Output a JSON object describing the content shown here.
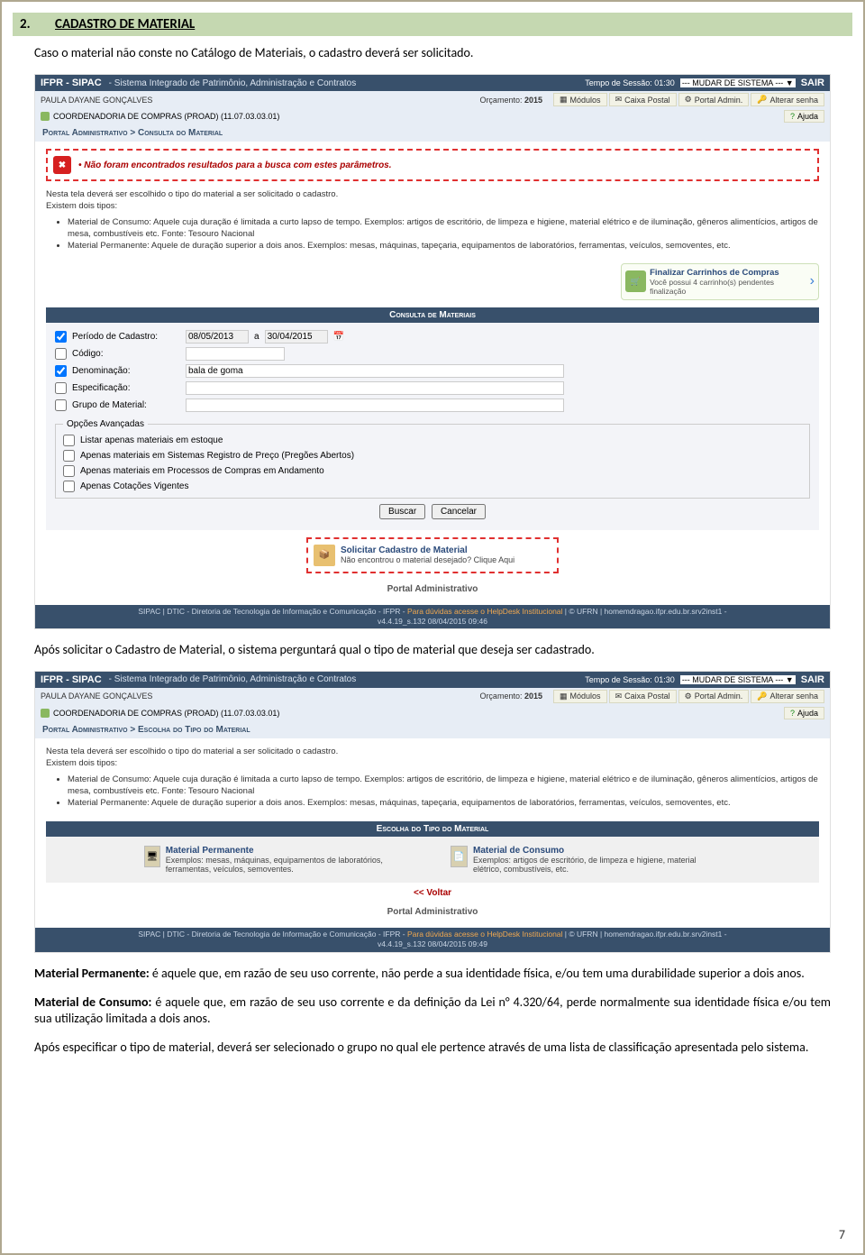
{
  "section": {
    "number": "2.",
    "title": "CADASTRO DE MATERIAL"
  },
  "intro_text": "Caso o material não conste no Catálogo de Materiais, o cadastro deverá ser solicitado.",
  "after_solicit_text": "Após solicitar o Cadastro de Material, o sistema perguntará qual o tipo de material que deseja ser cadastrado.",
  "mat_perm_label": "Material Permanente:",
  "mat_perm_text": " é aquele que, em razão de seu uso corrente, não perde a sua identidade física, e/ou tem uma durabilidade superior a dois anos.",
  "mat_cons_label": "Material de Consumo:",
  "mat_cons_text": " é aquele que, em razão de seu uso corrente e da definição da Lei n° 4.320/64, perde normalmente sua identidade física e/ou tem sua utilização limitada a dois anos.",
  "final_text": "Após especificar o tipo de material, deverá ser selecionado o grupo no qual ele pertence através de uma lista de classificação apresentada pelo sistema.",
  "page_number": "7",
  "app": {
    "brand": "IFPR - SIPAC",
    "subtitle": "- Sistema Integrado de Patrimônio, Administração e Contratos",
    "session": "Tempo de Sessão: 01:30",
    "mudar": "--- MUDAR DE SISTEMA --- ▼",
    "sair": "SAIR",
    "user": "PAULA DAYANE GONÇALVES",
    "dept": "COORDENADORIA DE COMPRAS (PROAD) (11.07.03.03.01)",
    "orcamento_label": "Orçamento:",
    "orcamento_year": "2015",
    "modlinks": {
      "modulos": "Módulos",
      "caixa": "Caixa Postal",
      "portal": "Portal Admin.",
      "alterar": "Alterar senha",
      "ajuda": "Ajuda"
    },
    "footer1": "SIPAC | DTIC - Diretoria de Tecnologia de Informação e Comunicação - IFPR - ",
    "footer_orange": "Para dúvidas acesse o HelpDesk Institucional",
    "footer2": " | © UFRN | homemdragao.ifpr.edu.br.srv2inst1 -",
    "portal_admin": "Portal Administrativo"
  },
  "shot1": {
    "breadcrumb": "Portal Administrativo > Consulta do Material",
    "error": "Não foram encontrados resultados para a busca com estes parâmetros.",
    "intro": "Nesta tela deverá ser escolhido o tipo do material a ser solicitado o cadastro.",
    "intro2": "Existem dois tipos:",
    "bullet1": "Material de Consumo: Aquele cuja duração é limitada a curto lapso de tempo. Exemplos: artigos de escritório, de limpeza e higiene, material elétrico e de iluminação, gêneros alimentícios, artigos de mesa, combustíveis etc. Fonte: Tesouro Nacional",
    "bullet2": "Material Permanente: Aquele de duração superior a dois anos. Exemplos: mesas, máquinas, tapeçaria, equipamentos de laboratórios, ferramentas, veículos, semoventes, etc.",
    "finalize_title": "Finalizar Carrinhos de Compras",
    "finalize_sub": "Você possui 4 carrinho(s) pendentes finalização",
    "consulta_header": "Consulta de Materiais",
    "fields": {
      "periodo_label": "Período de Cadastro:",
      "periodo_a": "a",
      "date_from": "08/05/2013",
      "date_to": "30/04/2015",
      "codigo": "Código:",
      "denominacao": "Denominação:",
      "denominacao_value": "bala de goma",
      "especificacao": "Especificação:",
      "grupo": "Grupo de Material:",
      "opcoes_legend": "Opções Avançadas",
      "adv1": "Listar apenas materiais em estoque",
      "adv2": "Apenas materiais em Sistemas Registro de Preço (Pregões Abertos)",
      "adv3": "Apenas materiais em Processos de Compras em Andamento",
      "adv4": "Apenas Cotações Vigentes",
      "buscar": "Buscar",
      "cancelar": "Cancelar"
    },
    "solicit_title": "Solicitar Cadastro de Material",
    "solicit_sub": "Não encontrou o material desejado? Clique Aqui",
    "footer_version": "v4.4.19_s.132 08/04/2015 09:46"
  },
  "shot2": {
    "breadcrumb": "Portal Administrativo > Escolha do Tipo do Material",
    "intro": "Nesta tela deverá ser escolhido o tipo do material a ser solicitado o cadastro.",
    "intro2": "Existem dois tipos:",
    "bullet1": "Material de Consumo: Aquele cuja duração é limitada a curto lapso de tempo. Exemplos: artigos de escritório, de limpeza e higiene, material elétrico e de iluminação, gêneros alimentícios, artigos de mesa, combustíveis etc. Fonte: Tesouro Nacional",
    "bullet2": "Material Permanente: Aquele de duração superior a dois anos. Exemplos: mesas, máquinas, tapeçaria, equipamentos de laboratórios, ferramentas, veículos, semoventes, etc.",
    "escolha_header": "Escolha do Tipo do Material",
    "choice_perm_title": "Material Permanente",
    "choice_perm_sub": "Exemplos: mesas, máquinas, equipamentos de laboratórios, ferramentas, veículos, semoventes.",
    "choice_cons_title": "Material de Consumo",
    "choice_cons_sub": "Exemplos: artigos de escritório, de limpeza e higiene, material elétrico, combustíveis, etc.",
    "voltar": "<< Voltar",
    "footer_version": "v4.4.19_s.132 08/04/2015 09:49"
  }
}
